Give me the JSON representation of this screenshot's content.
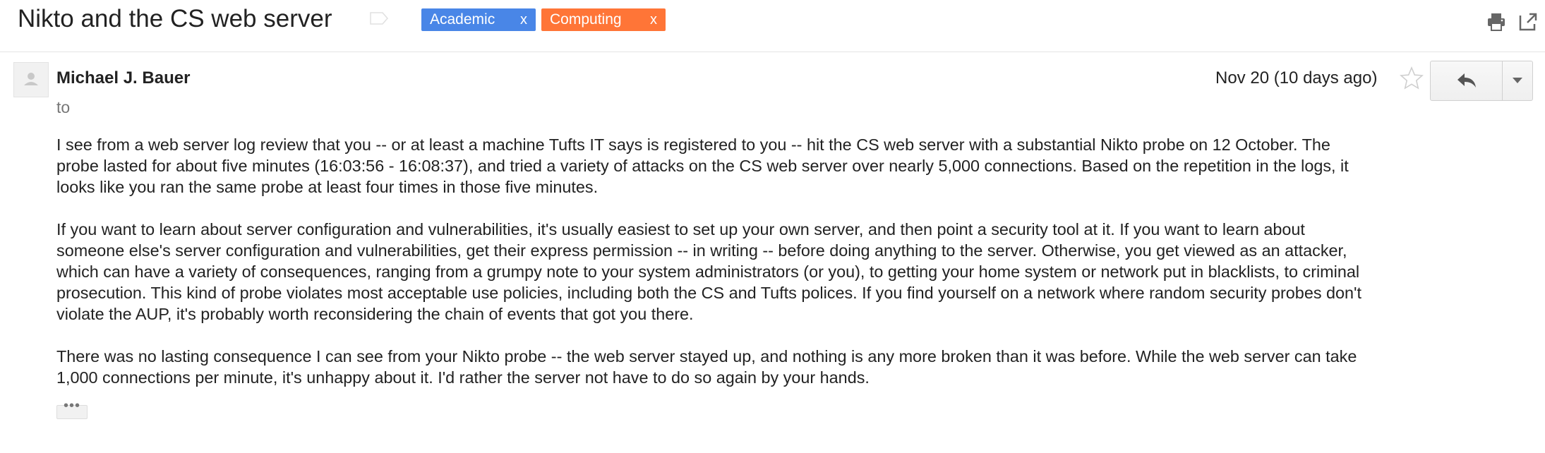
{
  "header": {
    "subject": "Nikto and the CS web server",
    "labels": [
      {
        "name": "Academic",
        "remove": "x",
        "color": "#4986e7"
      },
      {
        "name": "Computing",
        "remove": "x",
        "color": "#ff7537"
      }
    ],
    "icons": [
      "important-marker-icon",
      "print-icon",
      "popout-icon"
    ]
  },
  "message": {
    "sender": "Michael J. Bauer",
    "to_label": "to",
    "date": "Nov 20 (10 days ago)",
    "icons": [
      "star-icon",
      "reply-icon",
      "chevron-down-icon"
    ],
    "body": {
      "p1": [
        "I see from a web server log review that you -- or at least a machine Tufts IT says is registered to you -- hit the CS web server with a substantial Nikto probe on 12 October.  The",
        "probe lasted for about five minutes (16:03:56 - 16:08:37), and tried a variety of attacks on the CS web server over nearly 5,000 connections.  Based on the repetition in the logs, it",
        "looks like you ran the same probe at least four times in those five minutes."
      ],
      "p2": [
        "If you want to learn about server configuration and vulnerabilities, it's usually easiest to set up your own server, and then point a security tool at it.  If you want to learn about",
        "someone else's server configuration and vulnerabilities, get their express permission -- in writing -- before doing anything to the server. Otherwise, you get viewed as an attacker,",
        "which can have a variety of consequences, ranging from a grumpy note to your system administrators (or you), to getting your home system or network put in blacklists, to criminal",
        "prosecution.  This kind of probe violates most acceptable use policies, including both the CS and Tufts polices.  If you find yourself on a network where random security probes don't",
        "violate the AUP, it's probably worth reconsidering the chain of events that got you there."
      ],
      "p3": [
        "There was no lasting consequence I can see from your Nikto probe -- the web server stayed up, and nothing is any more broken than it was before.  While the web server can take",
        "1,000 connections per minute, it's unhappy about it.  I'd rather the server not have to do so again by your hands."
      ]
    },
    "show_trimmed": "•••"
  }
}
